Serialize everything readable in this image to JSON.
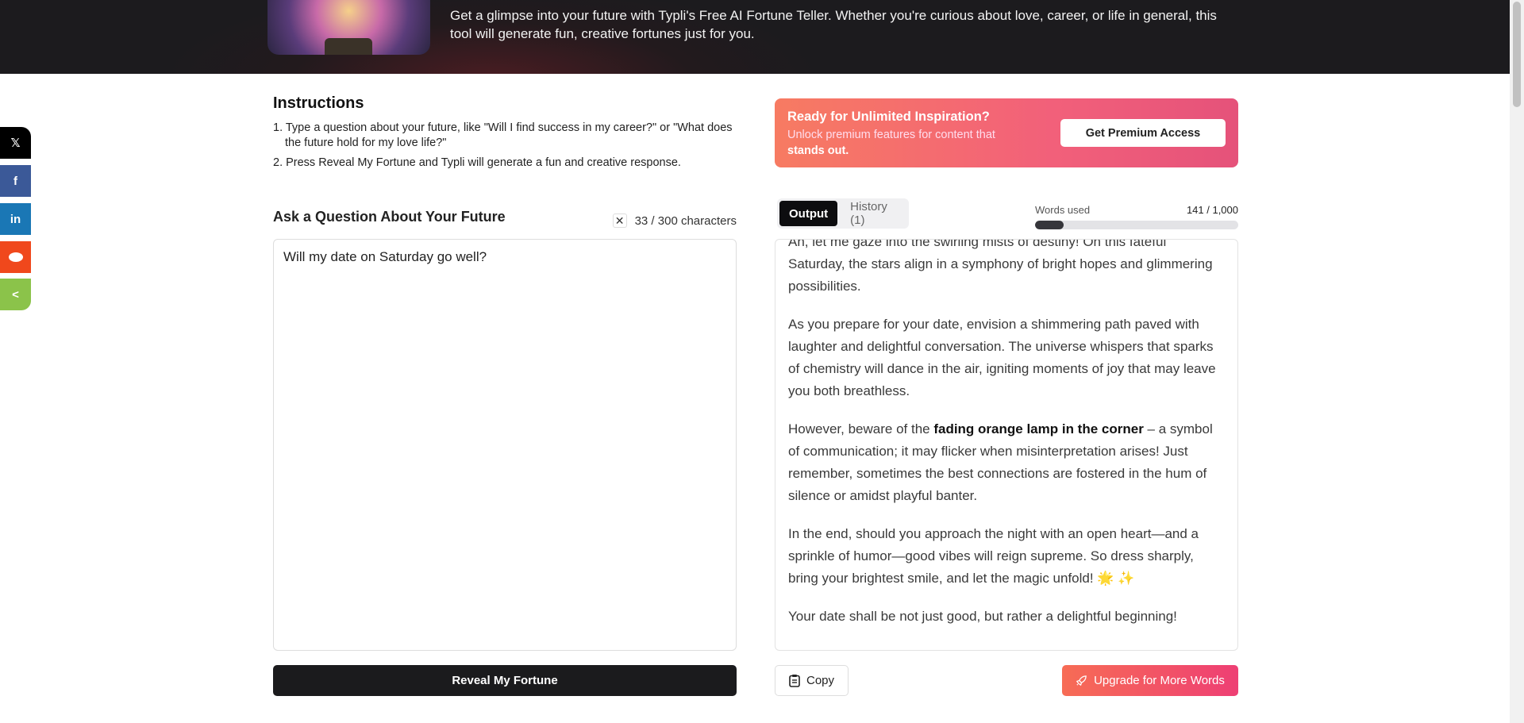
{
  "hero": {
    "description": "Get a glimpse into your future with Typli's Free AI Fortune Teller. Whether you're curious about love, career, or life in general, this tool will generate fun, creative fortunes just for you.",
    "image_icon": "crystal-ball-image"
  },
  "social": [
    {
      "name": "x",
      "icon": "x-icon",
      "glyph": "𝕏",
      "color": "#000000"
    },
    {
      "name": "facebook",
      "icon": "facebook-icon",
      "glyph": "f",
      "color": "#3b5998"
    },
    {
      "name": "linkedin",
      "icon": "linkedin-icon",
      "glyph": "in",
      "color": "#1a77b5"
    },
    {
      "name": "reddit",
      "icon": "reddit-icon",
      "glyph": "👽",
      "color": "#f0481c"
    },
    {
      "name": "share",
      "icon": "share-icon",
      "glyph": "<",
      "color": "#8bc34a"
    }
  ],
  "instructions": {
    "title": "Instructions",
    "items": [
      "1. Type a question about your future, like \"Will I find success in my career?\" or \"What does the future hold for my love life?\"",
      "2. Press Reveal My Fortune and Typli will generate a fun and creative response."
    ]
  },
  "input": {
    "title": "Ask a Question About Your Future",
    "counter": "33 / 300 characters",
    "clear_glyph": "✕",
    "value": "Will my date on Saturday go well?",
    "submit_label": "Reveal My Fortune"
  },
  "promo": {
    "title": "Ready for Unlimited Inspiration?",
    "text": "Unlock premium features for content that",
    "text_bold": "stands out.",
    "button": "Get Premium Access"
  },
  "output": {
    "tabs": [
      {
        "label": "Output",
        "active": true
      },
      {
        "label": "History (1)",
        "active": false
      }
    ],
    "words_label": "Words used",
    "words_value": "141 / 1,000",
    "words_used": 141,
    "words_limit": 1000,
    "paragraphs": {
      "p1": "Ah, let me gaze into the swirling mists of destiny! On this fateful Saturday, the stars align in a symphony of bright hopes and glimmering possibilities.",
      "p2": "As you prepare for your date, envision a shimmering path paved with laughter and delightful conversation. The universe whispers that sparks of chemistry will dance in the air, igniting moments of joy that may leave you both breathless.",
      "p3_before": "However, beware of the ",
      "p3_bold": "fading orange lamp in the corner",
      "p3_after": " – a symbol of communication; it may flicker when misinterpretation arises! Just remember, sometimes the best connections are fostered in the hum of silence or amidst playful banter.",
      "p4": "In the end, should you approach the night with an open heart—and a sprinkle of humor—good vibes will reign supreme. So dress sharply, bring your brightest smile, and let the magic unfold! 🌟 ✨",
      "p5": "Your date shall be not just good, but rather a delightful beginning!"
    },
    "copy_label": "Copy",
    "upgrade_label": "Upgrade for More Words",
    "accent": "#ee3f74"
  }
}
